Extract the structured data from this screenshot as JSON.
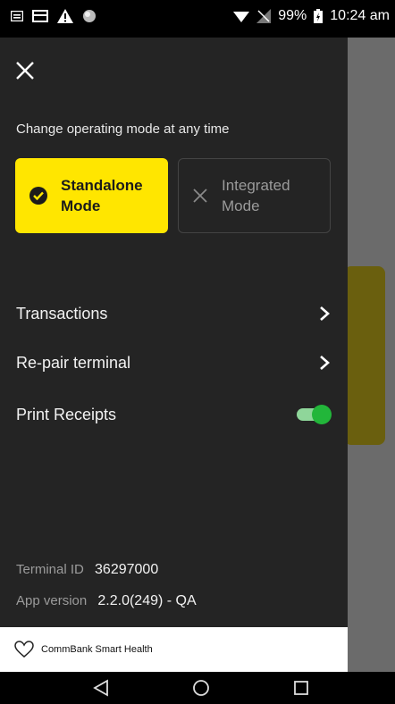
{
  "status": {
    "battery": "99%",
    "time": "10:24 am"
  },
  "drawer": {
    "helper_text": "Change operating mode at any time",
    "modes": [
      {
        "line1": "Standalone",
        "line2": "Mode",
        "selected": true
      },
      {
        "line1": "Integrated",
        "line2": "Mode",
        "selected": false
      }
    ],
    "menu": [
      {
        "label": "Transactions"
      },
      {
        "label": "Re-pair terminal"
      },
      {
        "label": "Print Receipts",
        "toggle_on": true
      }
    ],
    "terminal_id_label": "Terminal ID",
    "terminal_id_value": "36297000",
    "app_version_label": "App version",
    "app_version_value": "2.2.0(249) - QA",
    "brand_text": "CommBank Smart Health"
  },
  "colors": {
    "accent_yellow": "#ffe600",
    "toggle_green": "#22b63a",
    "drawer_bg": "#242424"
  }
}
